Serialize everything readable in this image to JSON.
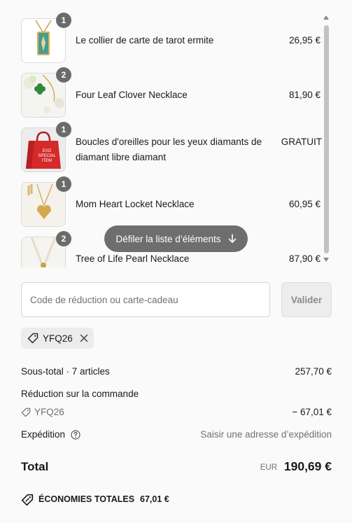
{
  "items": [
    {
      "name": "Le collier de carte de tarot ermite",
      "price": "26,95 €",
      "qty": "1",
      "thumb": "tarot-necklace"
    },
    {
      "name": "Four Leaf Clover Necklace",
      "price": "81,90 €",
      "qty": "2",
      "thumb": "clover-necklace"
    },
    {
      "name": "Boucles d'oreilles pour les yeux diamants de diamant libre diamant",
      "price": "GRATUIT",
      "qty": "1",
      "thumb": "special-item-bag",
      "bag_text": "EXO SPECIAL ITEM"
    },
    {
      "name": "Mom Heart Locket Necklace",
      "price": "60,95 €",
      "qty": "1",
      "thumb": "heart-locket"
    },
    {
      "name": "Tree of Life Pearl Necklace",
      "price": "87,90 €",
      "qty": "2",
      "thumb": "pearl-necklace"
    }
  ],
  "scroll_hint": "Défiler la liste d’éléments",
  "discount": {
    "placeholder": "Code de réduction ou carte-cadeau",
    "apply": "Valider",
    "applied_code": "YFQ26"
  },
  "summary": {
    "subtotal_label": "Sous-total · 7 articles",
    "subtotal_value": "257,70 €",
    "order_discount_label": "Réduction sur la commande",
    "code": "YFQ26",
    "discount_value": "− 67,01 €",
    "shipping_label": "Expédition",
    "shipping_value": "Saisir une adresse d’expédition",
    "total_label": "Total",
    "currency": "EUR",
    "total_value": "190,69 €",
    "savings_label": "ÉCONOMIES TOTALES",
    "savings_value": "67,01 €"
  },
  "colors": {
    "badge": "#6b6b6b",
    "bag_red": "#d42a2a",
    "pill": "#6e6e6e"
  }
}
